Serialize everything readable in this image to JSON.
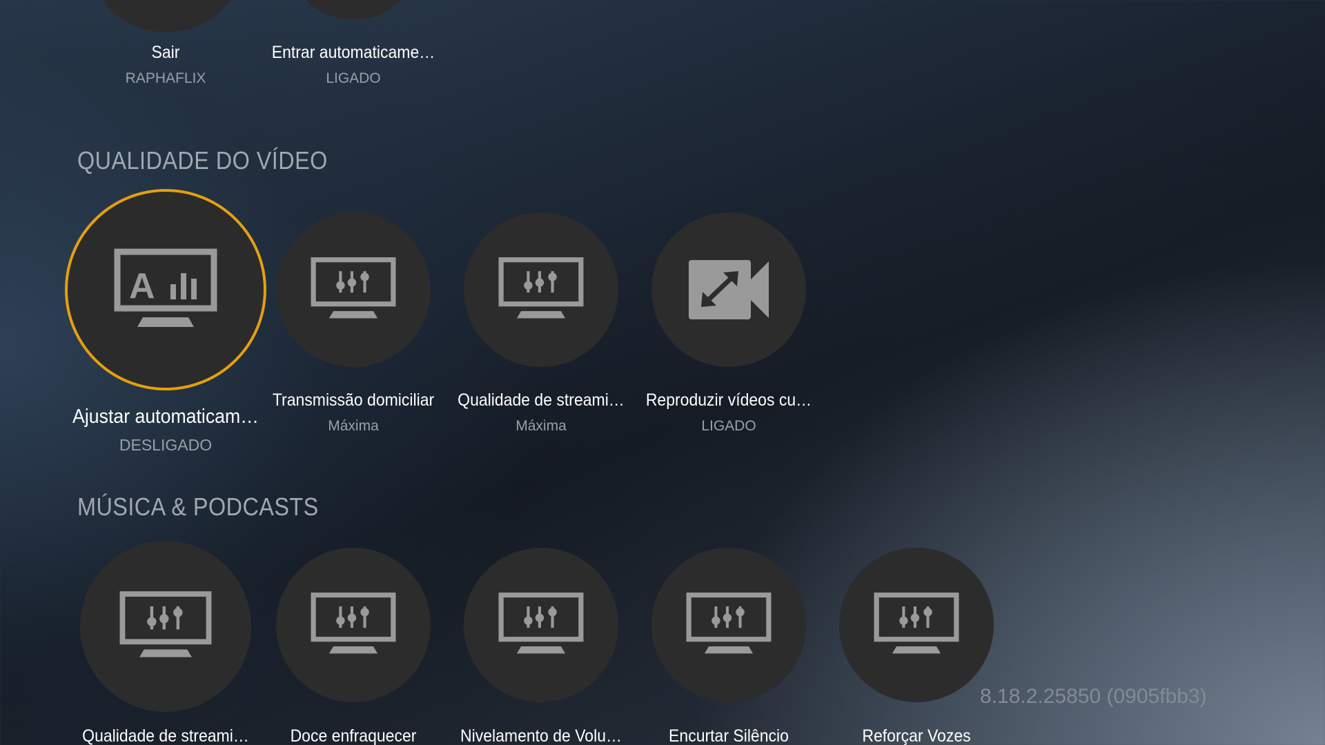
{
  "account_row": [
    {
      "title": "Sair",
      "subtitle": "RAPHAFLIX",
      "icon": "circle-icon"
    },
    {
      "title": "Entrar automaticame…",
      "subtitle": "LIGADO",
      "icon": "circle-icon"
    }
  ],
  "sections": {
    "video_quality": {
      "title": "QUALIDADE DO VÍDEO",
      "items": [
        {
          "title": "Ajustar automaticam…",
          "subtitle": "DESLIGADO",
          "icon": "auto-adjust-monitor-icon",
          "focused": true
        },
        {
          "title": "Transmissão domiciliar",
          "subtitle": "Máxima",
          "icon": "equalizer-monitor-icon"
        },
        {
          "title": "Qualidade de streami…",
          "subtitle": "Máxima",
          "icon": "equalizer-monitor-icon"
        },
        {
          "title": "Reproduzir vídeos cu…",
          "subtitle": "LIGADO",
          "icon": "video-expand-icon"
        }
      ]
    },
    "music_podcasts": {
      "title": "MÚSICA & PODCASTS",
      "items": [
        {
          "title": "Qualidade de streami…",
          "icon": "equalizer-monitor-icon"
        },
        {
          "title": "Doce enfraquecer",
          "icon": "equalizer-monitor-icon"
        },
        {
          "title": "Nivelamento de Volu…",
          "icon": "equalizer-monitor-icon"
        },
        {
          "title": "Encurtar Silêncio",
          "icon": "equalizer-monitor-icon"
        },
        {
          "title": "Reforçar Vozes",
          "icon": "equalizer-monitor-icon"
        }
      ]
    }
  },
  "version": "8.18.2.25850 (0905fbb3)",
  "colors": {
    "focus_ring": "#e5a00d",
    "circle_bg": "#2c2c2c",
    "icon_gray": "#9a9a9a"
  }
}
